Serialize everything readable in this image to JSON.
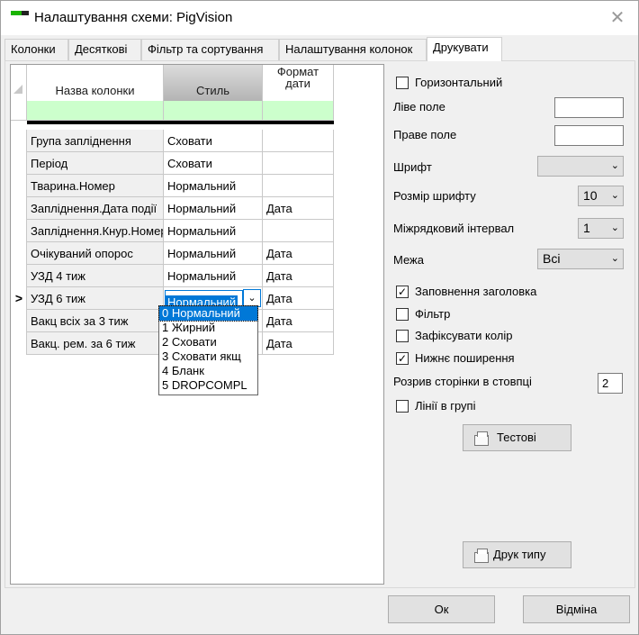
{
  "window": {
    "title": "Налаштування схеми: PigVision"
  },
  "tabs": [
    "Колонки",
    "Десяткові",
    "Фільтр та сортування",
    "Налаштування колонок",
    "Друкувати"
  ],
  "grid": {
    "headers": {
      "name": "Назва колонки",
      "style": "Стиль",
      "date_format": "Формат\nдати"
    },
    "rows": [
      {
        "name": "Група запліднення",
        "style": "Сховати",
        "date": ""
      },
      {
        "name": "Період",
        "style": "Сховати",
        "date": ""
      },
      {
        "name": "Тварина.Номер",
        "style": "Нормальний",
        "date": ""
      },
      {
        "name": "Запліднення.Дата події",
        "style": "Нормальний",
        "date": "Дата"
      },
      {
        "name": "Запліднення.Кнур.Номер",
        "style": "Нормальний",
        "date": ""
      },
      {
        "name": "Очікуваний опорос",
        "style": "Нормальний",
        "date": "Дата"
      },
      {
        "name": "УЗД 4 тиж",
        "style": "Нормальний",
        "date": "Дата"
      },
      {
        "name": "УЗД 6 тиж",
        "style": "Нормальний",
        "date": "Дата",
        "current": true
      },
      {
        "name": "Вакц всіх за 3 тиж",
        "style": "",
        "date": "Дата"
      },
      {
        "name": "Вакц. рем. за 6 тиж",
        "style": "",
        "date": "Дата"
      }
    ],
    "current_marker": ">",
    "dropdown_options": [
      "0 Нормальний",
      "1 Жирний",
      "2 Сховати",
      "3 Сховати якщ",
      "4 Бланк",
      "5 DROPCOMPL"
    ],
    "dropdown_selected_index": 0
  },
  "print": {
    "horizontal": {
      "label": "Горизонтальний",
      "checked": false
    },
    "left_margin": {
      "label": "Ліве поле",
      "value": ""
    },
    "right_margin": {
      "label": "Праве поле",
      "value": ""
    },
    "font": {
      "label": "Шрифт",
      "value": ""
    },
    "font_size": {
      "label": "Розмір шрифту",
      "value": "10"
    },
    "line_spacing": {
      "label": "Міжрядковий інтервал",
      "value": "1"
    },
    "border": {
      "label": "Межа",
      "value": "Всі"
    },
    "fill_header": {
      "label": "Заповнення заголовка",
      "checked": true
    },
    "filter": {
      "label": "Фільтр",
      "checked": false
    },
    "fix_color": {
      "label": "Зафіксувати колір",
      "checked": false
    },
    "bottom_extend": {
      "label": "Нижнє поширення",
      "checked": true
    },
    "page_break": {
      "label": "Розрив сторінки в стовпці",
      "value": "2"
    },
    "group_lines": {
      "label": "Лінії в групі",
      "checked": false
    },
    "test_button": "Тестові",
    "print_type_button": "Друк типу"
  },
  "footer": {
    "ok": "Ок",
    "cancel": "Відміна"
  }
}
